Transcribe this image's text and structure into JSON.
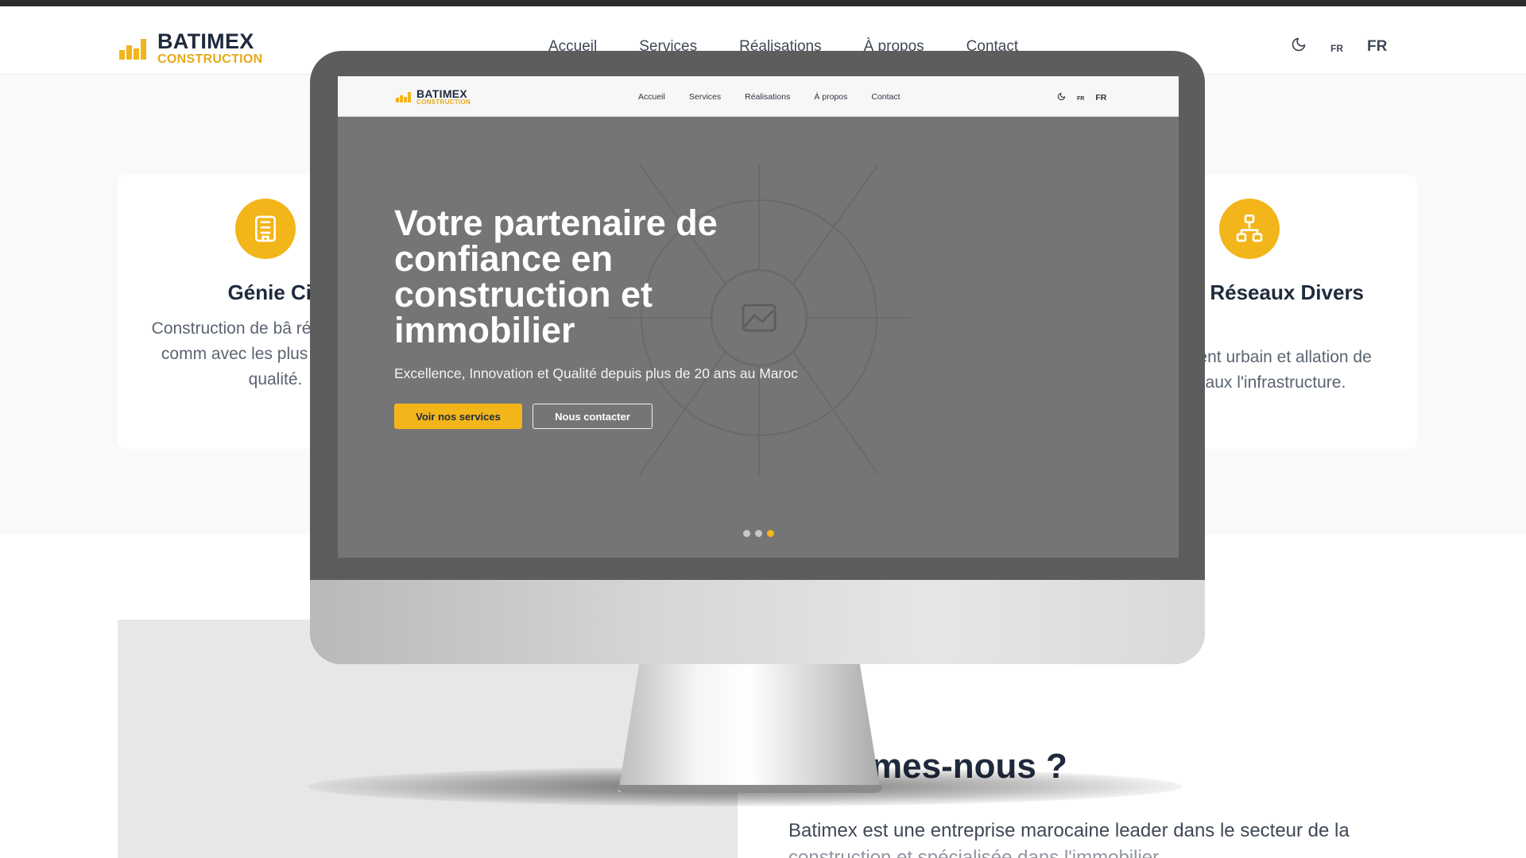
{
  "brand": {
    "name": "BATIMEX",
    "tagline": "CONSTRUCTION",
    "accent": "#f2b51a",
    "dark": "#1f2a3d"
  },
  "nav": [
    {
      "label": "Accueil"
    },
    {
      "label": "Services"
    },
    {
      "label": "Réalisations"
    },
    {
      "label": "À propos"
    },
    {
      "label": "Contact"
    }
  ],
  "header_right": {
    "theme_icon": "moon-icon",
    "lang_small": "FR",
    "lang_big": "FR"
  },
  "services": {
    "left_card": {
      "icon": "building-icon",
      "title": "Génie Civ",
      "description": "Construction de bâ résidentiels et comm avec les plus hauts s de qualité."
    },
    "right_card": {
      "icon": "network-icon",
      "title": "rie et Réseaux Divers",
      "description": "nagement urbain et allation de réseaux l'infrastructure."
    }
  },
  "about": {
    "title": "ommes-nous ?",
    "text": "Batimex est une entreprise marocaine leader dans le secteur de la",
    "text2": "construction et spécialisée dans l'immobilier"
  },
  "hero": {
    "title": "Votre partenaire de confiance en construction et immobilier",
    "subtitle": "Excellence, Innovation et Qualité depuis plus de 20 ans au Maroc",
    "primary_button": "Voir nos services",
    "secondary_button": "Nous contacter",
    "image_icon": "image-placeholder-icon",
    "slide_count": 3,
    "active_slide": 3
  }
}
